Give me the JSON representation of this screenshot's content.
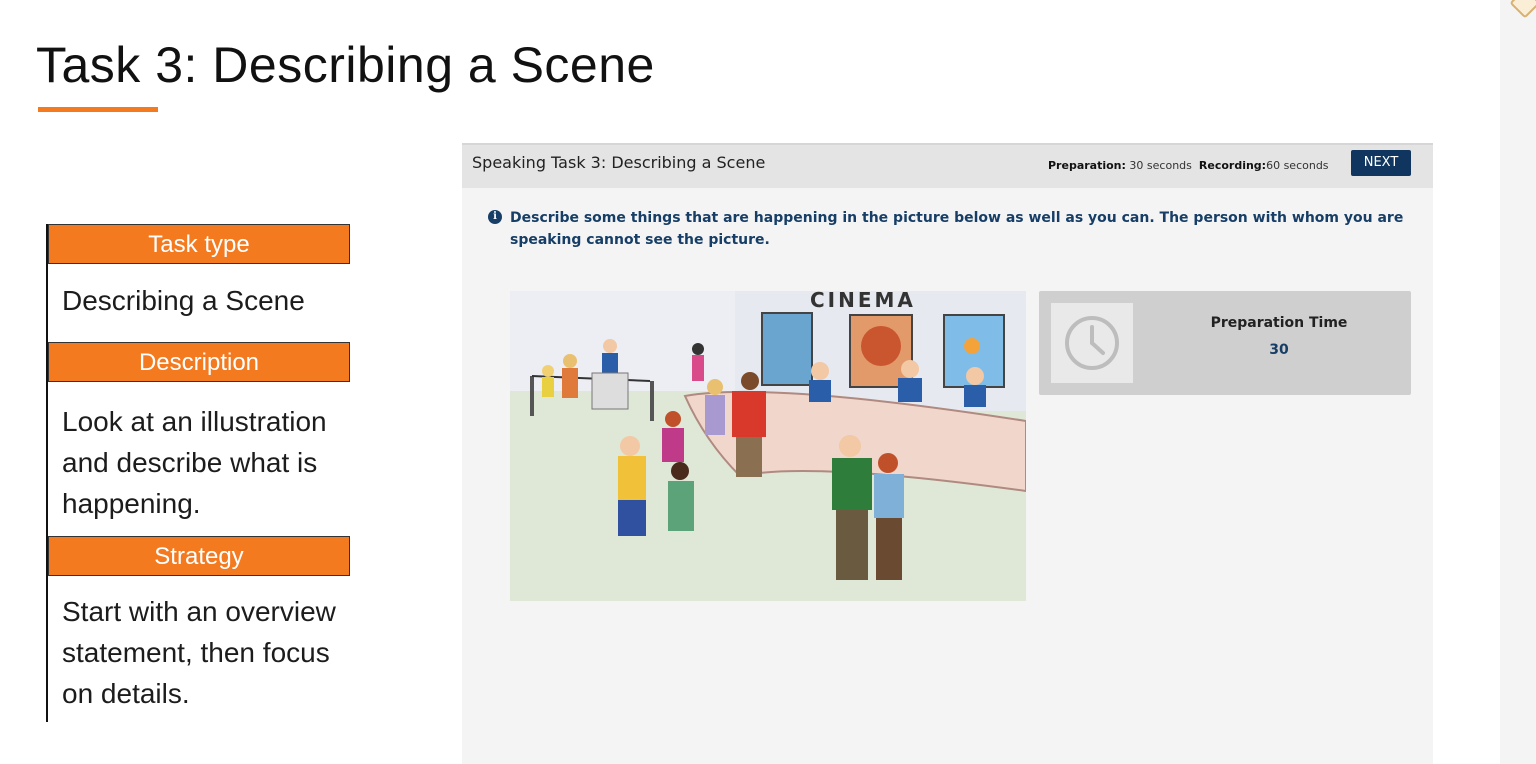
{
  "slide": {
    "title": "Task 3: Describing a Scene",
    "accent_color": "#f47a20"
  },
  "side_panel": {
    "task_type_heading": "Task type",
    "task_type_text": "Describing a Scene",
    "description_heading": "Description",
    "description_text": "Look at an illustration and describe what is happening.",
    "strategy_heading": "Strategy",
    "strategy_text": "Start with an overview statement, then focus on details."
  },
  "test_window": {
    "header_title": "Speaking Task 3: Describing a Scene",
    "preparation_label": "Preparation:",
    "preparation_value": "30 seconds",
    "recording_label": "Recording:",
    "recording_value": "60 seconds",
    "next_label": "NEXT",
    "instruction": "Describe some things that are happening in the picture below as well as you can. The person with whom you are speaking cannot see the picture.",
    "info_icon": "info-circle-icon",
    "illustration_sign": "CINEMA",
    "prep_title": "Preparation Time",
    "prep_value": "30",
    "clock_icon": "clock-icon",
    "brand_color": "#10365f"
  }
}
